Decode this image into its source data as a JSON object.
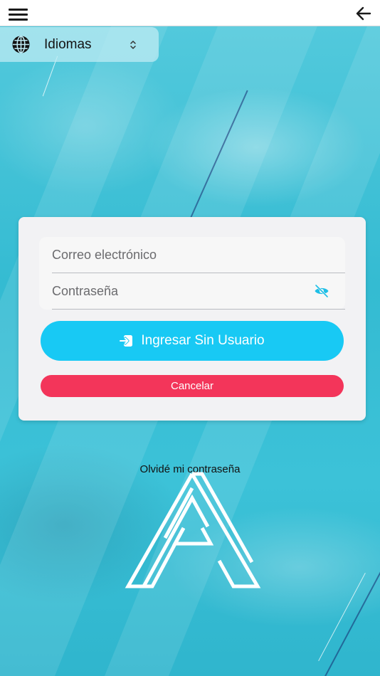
{
  "topbar": {
    "menu_icon": "hamburger-menu-icon",
    "back_icon": "arrow-left-icon"
  },
  "language": {
    "icon": "globe-icon",
    "label": "Idiomas",
    "chevron_icon": "chevron-up-down-icon"
  },
  "form": {
    "email_placeholder": "Correo electrónico",
    "email_value": "",
    "password_placeholder": "Contraseña",
    "password_value": "",
    "eye_icon": "eye-off-icon",
    "guest_button_label": "Ingresar Sin Usuario",
    "guest_button_icon": "login-enter-icon",
    "cancel_button_label": "Cancelar"
  },
  "forgot_password_label": "Olvidé mi contraseña",
  "colors": {
    "accent": "#18c9f4",
    "danger": "#f3355a",
    "background": "#3fc6da"
  }
}
